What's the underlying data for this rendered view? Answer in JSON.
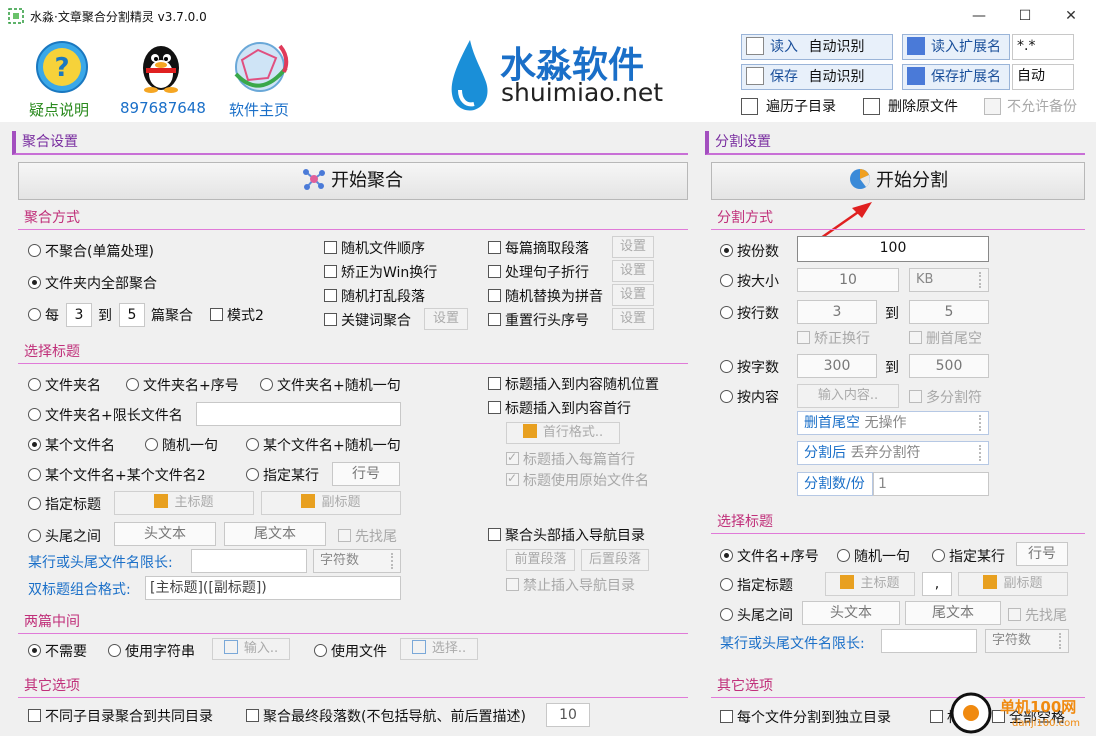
{
  "window": {
    "title": "水淼·文章聚合分割精灵 v3.7.0.0"
  },
  "header": {
    "tools": [
      {
        "label": "疑点说明"
      },
      {
        "label": "897687648"
      },
      {
        "label": "软件主页"
      }
    ],
    "logo_cn": "水淼软件",
    "logo_en": "shuimiao.net",
    "read_label": "读入",
    "read_value": "自动识别",
    "save_label": "保存",
    "save_value": "自动识别",
    "read_ext_label": "读入扩展名",
    "read_ext_value": "*.*",
    "save_ext_label": "保存扩展名",
    "save_ext_value": "自动",
    "traverse_subdir": "遍历子目录",
    "delete_original": "删除原文件",
    "no_backup": "不允许备份"
  },
  "merge": {
    "section_title": "聚合设置",
    "start_button": "开始聚合",
    "method": {
      "title": "聚合方式",
      "no_merge": "不聚合(单篇处理)",
      "all_in_folder": "文件夹内全部聚合",
      "every": "每",
      "every_from": "3",
      "to": "到",
      "every_to": "5",
      "articles_merge": "篇聚合",
      "mode2": "模式2",
      "random_order": "随机文件顺序",
      "fix_win_newline": "矫正为Win换行",
      "random_shuffle": "随机打乱段落",
      "keyword_merge": "关键词聚合",
      "keyword_set": "设置",
      "each_extract": "每篇摘取段落",
      "sentence_wrap": "处理句子折行",
      "random_pinyin": "随机替换为拼音",
      "reset_line_numbers": "重置行头序号",
      "set": "设置"
    },
    "title_sel": {
      "title": "选择标题",
      "folder_name": "文件夹名",
      "folder_name_seq": "文件夹名+序号",
      "folder_name_random": "文件夹名+随机一句",
      "folder_name_limit": "文件夹名+限长文件名",
      "a_file_name": "某个文件名",
      "random_sentence": "随机一句",
      "a_file_random": "某个文件名+随机一句",
      "a_file_two": "某个文件名+某个文件名2",
      "specified_line": "指定某行",
      "line_no_placeholder": "行号",
      "specified_title": "指定标题",
      "main_title": "主标题",
      "sub_title": "副标题",
      "between": "头尾之间",
      "head_text": "头文本",
      "tail_text": "尾文本",
      "head_first": "先找尾",
      "limit_label": "某行或头尾文件名限长:",
      "char_count": "字符数",
      "double_format_label": "双标题组合格式:",
      "double_format_value": "[主标题]([副标题])",
      "insert_random": "标题插入到内容随机位置",
      "insert_first": "标题插入到内容首行",
      "first_line_format": "首行格式..",
      "insert_each_first": "标题插入每篇首行",
      "use_original_name": "标题使用原始文件名",
      "merge_nav": "聚合头部插入导航目录",
      "prefix_para": "前置段落",
      "suffix_para": "后置段落",
      "disable_nav": "禁止插入导航目录"
    },
    "between_articles": {
      "title": "两篇中间",
      "none": "不需要",
      "use_string": "使用字符串",
      "input": "输入..",
      "use_file": "使用文件",
      "select": "选择.."
    },
    "other": {
      "title": "其它选项",
      "diff_subdir": "不同子目录聚合到共同目录",
      "final_para": "聚合最终段落数(不包括导航、前后置描述)",
      "final_para_value": "10"
    }
  },
  "split": {
    "section_title": "分割设置",
    "start_button": "开始分割",
    "method": {
      "title": "分割方式",
      "by_parts": "按份数",
      "parts_value": "100",
      "by_size": "按大小",
      "size_value": "10",
      "size_unit": "KB",
      "by_lines": "按行数",
      "lines_from": "3",
      "to": "到",
      "lines_to": "5",
      "fix_newline": "矫正换行",
      "delete_head_tail": "删首尾空",
      "by_chars": "按字数",
      "chars_from": "300",
      "chars_to": "500",
      "by_content": "按内容",
      "input_content": "输入内容..",
      "multi_sep": "多分割符",
      "delete_label": "删首尾空",
      "delete_value": "无操作",
      "after_split_label": "分割后",
      "after_split_value": "丢弃分割符",
      "split_count_label": "分割数/份",
      "split_count_value": "1"
    },
    "title_sel": {
      "title": "选择标题",
      "file_name_seq": "文件名+序号",
      "random_sentence": "随机一句",
      "specified_line": "指定某行",
      "line_no_placeholder": "行号",
      "specified_title": "指定标题",
      "main_title": "主标题",
      "comma": ",",
      "sub_title": "副标题",
      "between": "头尾之间",
      "head_text": "头文本",
      "tail_text": "尾文本",
      "head_first": "先找尾",
      "limit_label": "某行或头尾文件名限长:",
      "char_count": "字符数"
    },
    "other": {
      "title": "其它选项",
      "each_file_dir": "每个文件分割到独立目录",
      "title_label": "标题",
      "full_space": "全部空格"
    }
  },
  "watermark": {
    "cn": "单机100网",
    "en": "danji100.com"
  }
}
